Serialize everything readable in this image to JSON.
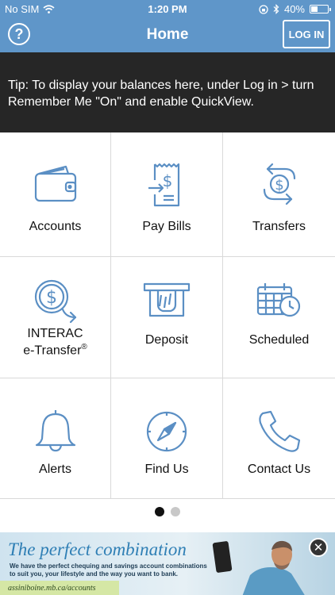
{
  "status_bar": {
    "carrier": "No SIM",
    "time": "1:20 PM",
    "battery_percent": "40%",
    "battery_level": 0.4
  },
  "nav": {
    "help_symbol": "?",
    "title": "Home",
    "login_label": "LOG IN"
  },
  "tip": {
    "text": "Tip: To display your balances here, under Log in > turn Remember Me \"On\" and enable QuickView."
  },
  "menu": {
    "items": [
      {
        "label": "Accounts",
        "icon": "wallet-icon"
      },
      {
        "label": "Pay Bills",
        "icon": "bill-icon"
      },
      {
        "label": "Transfers",
        "icon": "transfer-icon"
      },
      {
        "label_line1": "INTERAC",
        "label_line2": "e-Transfer",
        "label_mark": "®",
        "icon": "etransfer-icon"
      },
      {
        "label": "Deposit",
        "icon": "deposit-icon"
      },
      {
        "label": "Scheduled",
        "icon": "calendar-clock-icon"
      },
      {
        "label": "Alerts",
        "icon": "bell-icon"
      },
      {
        "label": "Find Us",
        "icon": "compass-icon"
      },
      {
        "label": "Contact Us",
        "icon": "phone-icon"
      }
    ]
  },
  "pager": {
    "pages": 2,
    "active": 1
  },
  "ad": {
    "headline": "The perfect combination",
    "subtext": "We have the perfect chequing and savings account combinations to suit you, your lifestyle and the way you want to bank.",
    "url": "assiniboine.mb.ca/accounts",
    "close_symbol": "✕"
  },
  "colors": {
    "brand_blue": "#5f96c9",
    "icon_blue": "#5b8fc4",
    "tip_bg": "#262626"
  }
}
